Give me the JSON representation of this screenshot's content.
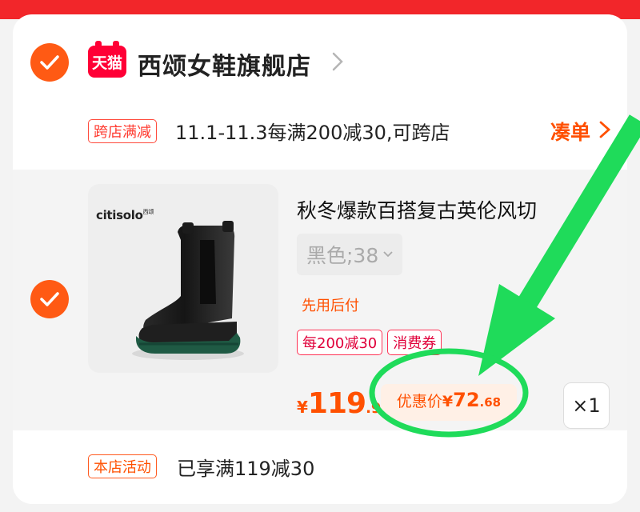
{
  "store": {
    "logo_text": "天猫",
    "name": "西颂女鞋旗舰店"
  },
  "promo": {
    "tag": "跨店满减",
    "text": "11.1-11.3每满200减30,可跨店",
    "action": "凑单"
  },
  "product": {
    "brand": "citisolo",
    "brand_suffix": "西颂",
    "title": "秋冬爆款百搭复古英伦风切",
    "sku": "黑色;38",
    "pay_later": "先用后付",
    "tags": [
      "每200减30",
      "消费券"
    ],
    "price": {
      "currency": "¥",
      "integer": "119",
      "decimal": ".9"
    },
    "discount": {
      "label": "优惠价",
      "currency": "¥",
      "integer": "72",
      "decimal": ".68"
    },
    "quantity": "×1"
  },
  "activity": {
    "tag": "本店活动",
    "text": "已享满119减30"
  },
  "colors": {
    "accent": "#ff5000",
    "brand_red": "#f2262a",
    "tmall_red": "#ff0036",
    "annotation_green": "#1fdb5a"
  }
}
